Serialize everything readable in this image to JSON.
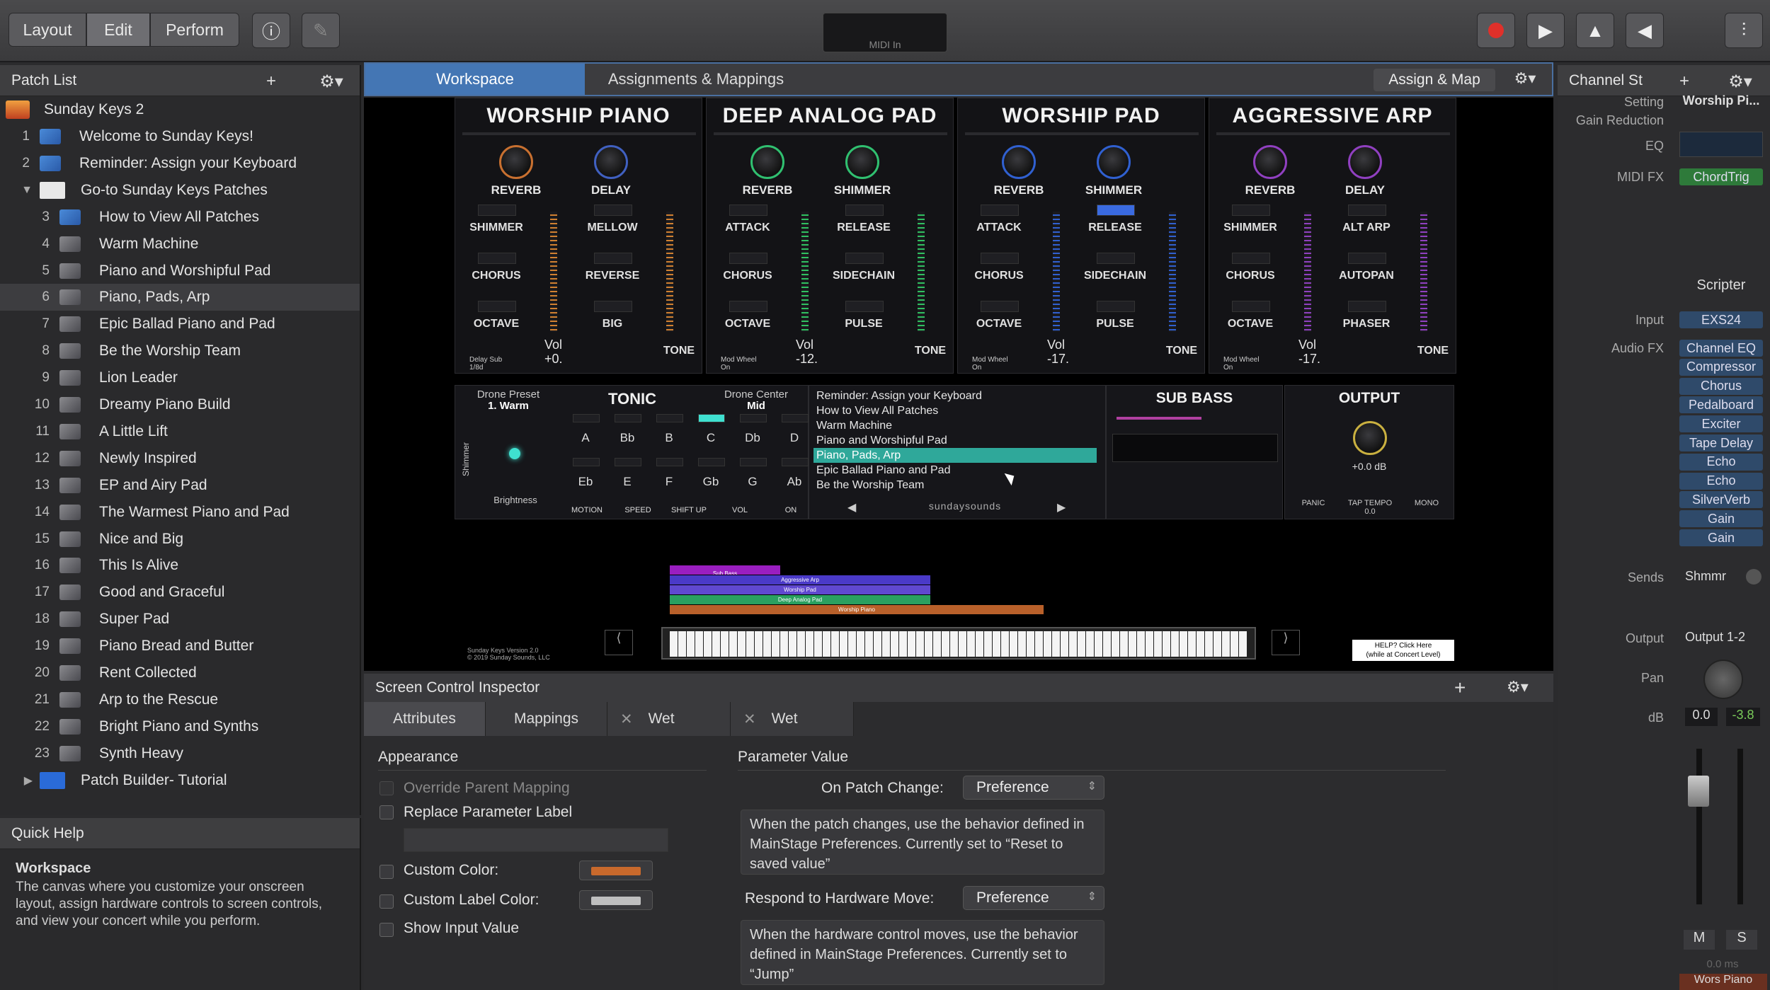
{
  "toolbar": {
    "modes": [
      "Layout",
      "Edit",
      "Perform"
    ],
    "midi_label": "MIDI In"
  },
  "patch_list": {
    "title": "Patch List",
    "concert": "Sunday Keys 2",
    "rows": [
      {
        "num": "1",
        "label": "Welcome to Sunday Keys!"
      },
      {
        "num": "2",
        "label": "Reminder: Assign your Keyboard"
      },
      {
        "num": "",
        "label": "Go-to Sunday Keys Patches"
      },
      {
        "num": "3",
        "label": "How to View All Patches"
      },
      {
        "num": "4",
        "label": "Warm Machine"
      },
      {
        "num": "5",
        "label": "Piano and Worshipful Pad"
      },
      {
        "num": "6",
        "label": "Piano, Pads, Arp"
      },
      {
        "num": "7",
        "label": "Epic Ballad Piano and Pad"
      },
      {
        "num": "8",
        "label": "Be the Worship Team"
      },
      {
        "num": "9",
        "label": "Lion Leader"
      },
      {
        "num": "10",
        "label": "Dreamy Piano Build"
      },
      {
        "num": "11",
        "label": "A Little Lift"
      },
      {
        "num": "12",
        "label": "Newly Inspired"
      },
      {
        "num": "13",
        "label": "EP and Airy Pad"
      },
      {
        "num": "14",
        "label": "The Warmest Piano and Pad"
      },
      {
        "num": "15",
        "label": "Nice and Big"
      },
      {
        "num": "16",
        "label": "This Is Alive"
      },
      {
        "num": "17",
        "label": "Good and Graceful"
      },
      {
        "num": "18",
        "label": "Super Pad"
      },
      {
        "num": "19",
        "label": "Piano Bread and Butter"
      },
      {
        "num": "20",
        "label": "Rent Collected"
      },
      {
        "num": "21",
        "label": "Arp to the Rescue"
      },
      {
        "num": "22",
        "label": "Bright Piano and Synths"
      },
      {
        "num": "23",
        "label": "Synth Heavy"
      },
      {
        "num": "",
        "label": "Patch Builder- Tutorial"
      }
    ]
  },
  "quick_help": {
    "title": "Quick Help",
    "heading": "Workspace",
    "text": "The canvas where you customize your onscreen layout, assign hardware controls to screen controls, and view your concert while you perform."
  },
  "workspace": {
    "tabs": [
      "Workspace",
      "Assignments & Mappings"
    ],
    "assign_map": "Assign & Map"
  },
  "instruments": [
    {
      "title": "WORSHIP PIANO",
      "knobs": [
        "REVERB",
        "DELAY"
      ],
      "left": [
        "SHIMMER",
        "CHORUS",
        "OCTAVE"
      ],
      "right": [
        "MELLOW",
        "REVERSE",
        "BIG"
      ],
      "tone": "TONE",
      "vol": "Vol",
      "vol_value": "+0.",
      "small": "Delay Sub\n1/8d"
    },
    {
      "title": "DEEP ANALOG PAD",
      "knobs": [
        "REVERB",
        "SHIMMER"
      ],
      "left": [
        "ATTACK",
        "CHORUS",
        "OCTAVE"
      ],
      "right": [
        "RELEASE",
        "SIDECHAIN",
        "PULSE"
      ],
      "tone": "TONE",
      "vol": "Vol",
      "vol_value": "-12.",
      "small": "Mod Wheel\nOn"
    },
    {
      "title": "WORSHIP PAD",
      "knobs": [
        "REVERB",
        "SHIMMER"
      ],
      "left": [
        "ATTACK",
        "CHORUS",
        "OCTAVE"
      ],
      "right": [
        "RELEASE",
        "SIDECHAIN",
        "PULSE"
      ],
      "tone": "TONE",
      "vol": "Vol",
      "vol_value": "-17.",
      "small": "Mod Wheel\nOn"
    },
    {
      "title": "AGGRESSIVE ARP",
      "knobs": [
        "REVERB",
        "DELAY"
      ],
      "left": [
        "SHIMMER",
        "CHORUS",
        "OCTAVE"
      ],
      "right": [
        "ALT ARP",
        "AUTOPAN",
        "PHASER"
      ],
      "tone": "TONE",
      "vol": "Vol",
      "vol_value": "-17.",
      "small": "Mod Wheel\nOn"
    }
  ],
  "drone": {
    "preset_label": "Drone Preset",
    "preset_value": "1. Warm",
    "tonic": "TONIC",
    "center_label": "Drone Center",
    "center_value": "Mid",
    "notes_top": [
      "A",
      "Bb",
      "B",
      "C",
      "Db",
      "D"
    ],
    "notes_bottom": [
      "Eb",
      "E",
      "F",
      "Gb",
      "G",
      "Ab"
    ],
    "shimmer": "Shimmer",
    "brightness": "Brightness",
    "controls": [
      "MOTION",
      "SPEED",
      "SHIFT UP",
      "VOL",
      "ON"
    ]
  },
  "patch_menu": {
    "items": [
      "Reminder: Assign your Keyboard",
      "How to View All Patches",
      "Warm Machine",
      "Piano and Worshipful Pad",
      "Piano, Pads, Arp",
      "Epic Ballad Piano and Pad",
      "Be the Worship Team"
    ],
    "selected": 4,
    "brand": "sundaysounds"
  },
  "sub_bass": {
    "title": "SUB BASS"
  },
  "output": {
    "title": "OUTPUT",
    "db": "+0.0 dB",
    "buttons": [
      "PANIC",
      "TAP TEMPO",
      "MONO"
    ],
    "tempo": "0.0"
  },
  "layers": [
    "Sub Bass",
    "Aggressive Arp",
    "Worship Pad",
    "Deep Analog Pad",
    "Worship Piano"
  ],
  "footer": {
    "version": "Sunday Keys Version 2.0\n© 2019 Sunday Sounds, LLC",
    "help": "HELP? Click Here\n(while at Concert Level)"
  },
  "inspector": {
    "title": "Screen Control Inspector",
    "tabs": [
      "Attributes",
      "Mappings",
      "Wet",
      "Wet"
    ],
    "appearance": "Appearance",
    "override": "Override Parent Mapping",
    "replace_label": "Replace Parameter Label",
    "custom_color": "Custom Color:",
    "custom_label_color": "Custom Label Color:",
    "show_input": "Show Input Value",
    "param_value": "Parameter Value",
    "on_patch_change": "On Patch Change:",
    "on_patch_value": "Preference",
    "on_patch_desc": "When the patch changes, use the behavior defined in MainStage Preferences. Currently set to “Reset to saved value”",
    "hw_move": "Respond to Hardware Move:",
    "hw_value": "Preference",
    "hw_desc": "When the hardware control moves, use the behavior defined in MainStage Preferences. Currently set to “Jump”",
    "custom_color_hex": "#c8692c",
    "custom_label_color_hex": "#bfbfbf"
  },
  "channel_strip": {
    "title": "Channel St",
    "labels": {
      "setting": "Setting",
      "gain_reduction": "Gain Reduction",
      "eq": "EQ",
      "midi_fx": "MIDI FX",
      "input": "Input",
      "audio_fx": "Audio FX",
      "sends": "Sends",
      "output": "Output",
      "pan": "Pan",
      "db": "dB"
    },
    "setting_value": "Worship Pi...",
    "midi_fx_value": "ChordTrig",
    "scripter": "Scripter",
    "input_value": "EXS24",
    "audio_fx": [
      "Channel EQ",
      "Compressor",
      "Chorus",
      "Pedalboard",
      "Exciter",
      "Tape Delay",
      "Echo",
      "Echo",
      "SilverVerb",
      "Gain",
      "Gain"
    ],
    "send_value": "Shmmr",
    "output_value": "Output 1-2",
    "db_values": [
      "0.0",
      "-3.8"
    ],
    "m": "M",
    "s": "S",
    "ms": "0.0 ms",
    "bottom_name": "Wors Piano"
  }
}
